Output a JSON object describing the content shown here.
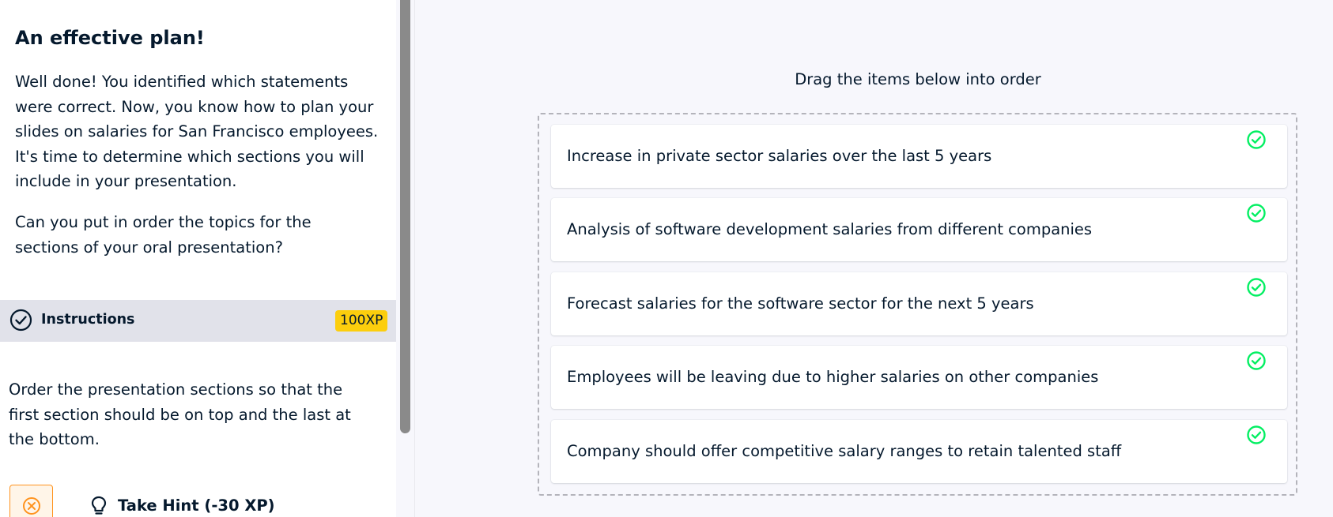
{
  "context": {
    "title": "An effective plan!",
    "paragraph1": "Well done! You identified which statements were correct. Now, you know how to plan your slides on salaries for San Francisco employees. It's time to determine which sections you will include in your presentation.",
    "paragraph2": "Can you put in order the topics for the sections of your oral presentation?"
  },
  "instructions": {
    "label": "Instructions",
    "xp": "100XP",
    "text": "Order the presentation sections so that the first section should be on top and the last at the bottom."
  },
  "hint": {
    "label": "Take Hint (-30 XP)"
  },
  "exercise": {
    "prompt": "Drag the items below into order",
    "items": [
      {
        "label": "Increase in private sector salaries over the last 5 years"
      },
      {
        "label": "Analysis of software development salaries from different companies"
      },
      {
        "label": "Forecast salaries for the software sector for the next 5 years"
      },
      {
        "label": "Employees will be leaving due to higher salaries on other companies"
      },
      {
        "label": "Company should offer competitive salary ranges to retain talented staff"
      }
    ]
  },
  "colors": {
    "correct": "#03ef62",
    "xp_badge": "#fcce0d",
    "hint_accent": "#ff931e"
  }
}
